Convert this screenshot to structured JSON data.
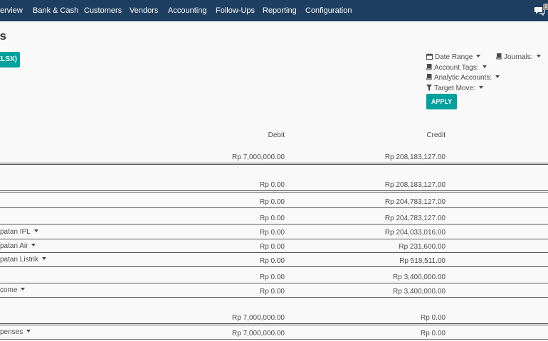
{
  "nav": {
    "items": [
      "erview",
      "Bank & Cash",
      "Customers",
      "Vendors",
      "Accounting",
      "Follow-Ups",
      "Reporting",
      "Configuration"
    ],
    "chat_badge": "2"
  },
  "page": {
    "title": "ss",
    "export_label": "XLSX)"
  },
  "filters": {
    "date_range": "Date Range",
    "journals": "Journals:",
    "account_tags": "Account Tags:",
    "analytic_accounts": "Analytic Accounts:",
    "target_move": "Target Move:",
    "apply": "APPLY"
  },
  "table": {
    "headers": {
      "debit": "Debit",
      "credit": "Credit"
    },
    "rows": [
      {
        "label": "",
        "debit": "Rp 7,000,000.00",
        "credit": "Rp 208,183,127.00",
        "dropdown": false
      },
      {
        "label": "",
        "debit": "Rp 0.00",
        "credit": "Rp 208,183,127.00",
        "dropdown": false
      },
      {
        "label": "",
        "debit": "Rp 0.00",
        "credit": "Rp 204,783,127.00",
        "dropdown": false
      },
      {
        "label": "",
        "debit": "Rp 0.00",
        "credit": "Rp 204,783,127.00",
        "dropdown": false
      },
      {
        "label": "patan IPL",
        "debit": "Rp 0.00",
        "credit": "Rp 204,033,016.00",
        "dropdown": true
      },
      {
        "label": "patan Air",
        "debit": "Rp 0.00",
        "credit": "Rp 231,600.00",
        "dropdown": true
      },
      {
        "label": "patan Listrik",
        "debit": "Rp 0.00",
        "credit": "Rp 518,511.00",
        "dropdown": true
      },
      {
        "label": "",
        "debit": "Rp 0.00",
        "credit": "Rp 3,400,000.00",
        "dropdown": false
      },
      {
        "label": "come",
        "debit": "Rp 0.00",
        "credit": "Rp 3,400,000.00",
        "dropdown": true
      },
      {
        "label": "",
        "debit": "Rp 7,000,000.00",
        "credit": "Rp 0.00",
        "dropdown": false
      },
      {
        "label": "penses",
        "debit": "Rp 7,000,000.00",
        "credit": "Rp 0.00",
        "dropdown": true
      }
    ]
  }
}
